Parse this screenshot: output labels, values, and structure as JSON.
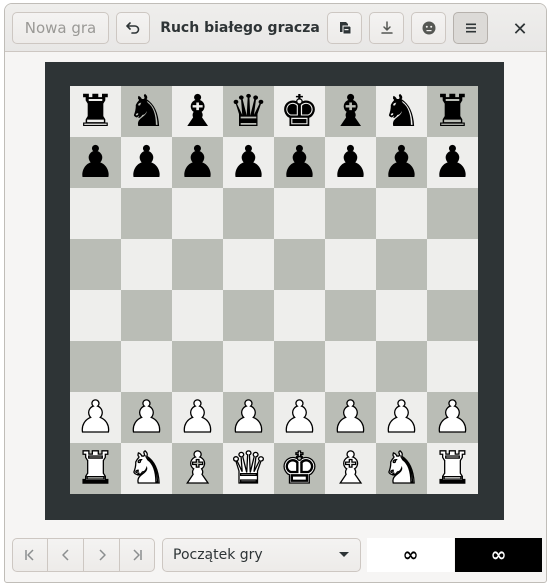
{
  "header": {
    "new_game_label": "Nowa gra",
    "title": "Ruch białego gracza",
    "close_glyph": "✕",
    "icons": [
      "undo-icon",
      "open-document-icon",
      "save-download-icon",
      "resign-face-icon",
      "hamburger-menu-icon",
      "close-icon"
    ]
  },
  "board": {
    "light_color": "#eeeeec",
    "dark_color": "#babdb6",
    "frame_color": "#2e3436",
    "ranks": [
      [
        "r",
        "n",
        "b",
        "q",
        "k",
        "b",
        "n",
        "r"
      ],
      [
        "p",
        "p",
        "p",
        "p",
        "p",
        "p",
        "p",
        "p"
      ],
      [
        "",
        "",
        "",
        "",
        "",
        "",
        "",
        ""
      ],
      [
        "",
        "",
        "",
        "",
        "",
        "",
        "",
        ""
      ],
      [
        "",
        "",
        "",
        "",
        "",
        "",
        "",
        ""
      ],
      [
        "",
        "",
        "",
        "",
        "",
        "",
        "",
        ""
      ],
      [
        "P",
        "P",
        "P",
        "P",
        "P",
        "P",
        "P",
        "P"
      ],
      [
        "R",
        "N",
        "B",
        "Q",
        "K",
        "B",
        "N",
        "R"
      ]
    ]
  },
  "footer": {
    "history_label": "Początek gry",
    "white_clock": "∞",
    "black_clock": "∞",
    "nav_icons": [
      "first-move-icon",
      "previous-move-icon",
      "next-move-icon",
      "last-move-icon"
    ]
  }
}
